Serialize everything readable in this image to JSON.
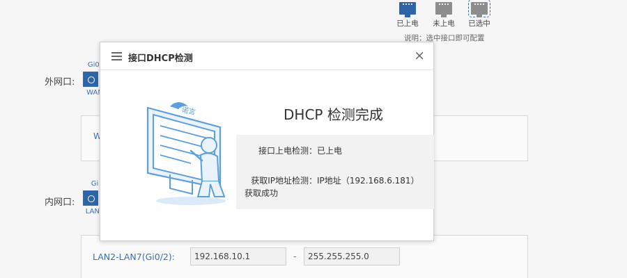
{
  "legend": {
    "items": [
      {
        "label": "已上电",
        "icon": "port-powered-icon",
        "color": "#2e64a8"
      },
      {
        "label": "未上电",
        "icon": "port-unpowered-icon",
        "color": "#8d8d8d"
      },
      {
        "label": "已选中",
        "icon": "port-selected-icon",
        "color": "#8d8d8d"
      }
    ],
    "note": "说明：选中接口即可配置"
  },
  "wan": {
    "row_label": "外网口:",
    "port_tag": "Gi0/",
    "port_name": "WAN",
    "panel_text": "W"
  },
  "lan": {
    "row_label": "内网口:",
    "port_tag": "Gi",
    "port_name": "LAN2",
    "field_label": "LAN2-LAN7(Gi0/2):",
    "ip_value": "192.168.10.1",
    "separator": "-",
    "mask_value": "255.255.255.0"
  },
  "modal": {
    "title": "接口DHCP检测",
    "close_label": "×",
    "result_title": "DHCP 检测完成",
    "rows": [
      {
        "key": "接口上电检测：",
        "value": "已上电"
      },
      {
        "key": "获取IP地址检测：",
        "value": "IP地址（192.168.6.181）"
      }
    ],
    "result_suffix": "获取成功",
    "illustration_caption": "诺言"
  },
  "colors": {
    "accent": "#2e64a8",
    "link": "#3a6db3",
    "illustration": "#5b9fe0"
  }
}
